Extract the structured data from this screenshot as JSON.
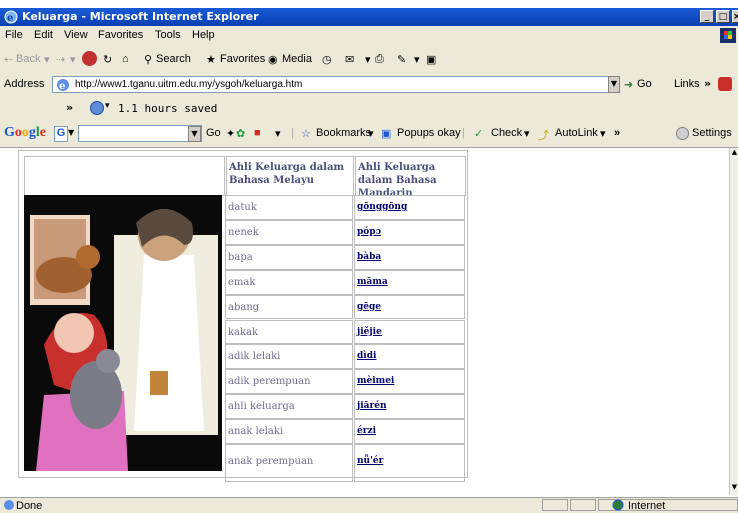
{
  "window": {
    "title": "Keluarga - Microsoft Internet Explorer",
    "buttons": [
      "_",
      "×"
    ]
  },
  "menu": {
    "items": [
      "File",
      "Edit",
      "View",
      "Favorites",
      "Tools",
      "Help"
    ]
  },
  "toolbar": {
    "back": "Back",
    "search": "Search",
    "favorites": "Favorites",
    "media": "Media"
  },
  "address": {
    "label": "Address",
    "url": "http://www1.tganu.uitm.edu.my/ysgoh/keluarga.htm",
    "go": "Go",
    "links": "Links"
  },
  "saved": {
    "chevron": "»",
    "text": "1.1 hours saved"
  },
  "google_bar": {
    "logo": "Google",
    "g_button": "G",
    "go": "Go",
    "bookmarks": "Bookmarks",
    "popups": "Popups okay",
    "check": "Check",
    "autolink": "AutoLink",
    "more": "»",
    "settings": "Settings"
  },
  "table": {
    "header_malay": "Ahli Keluarga dalam Bahasa Melayu",
    "header_mandarin": "Ahli Keluarga dalam Bahasa Mandarin",
    "rows": [
      {
        "malay": "datuk",
        "mandarin": "gōnggōng"
      },
      {
        "malay": "nenek",
        "mandarin": "pópɔ"
      },
      {
        "malay": "bapa",
        "mandarin": "bàba"
      },
      {
        "malay": "emak",
        "mandarin": "māma"
      },
      {
        "malay": "abang",
        "mandarin": "gēge"
      },
      {
        "malay": "kakak",
        "mandarin": "jiějie"
      },
      {
        "malay": "adik lelaki",
        "mandarin": "dìdi"
      },
      {
        "malay": "adik perempuan",
        "mandarin": "mèimei"
      },
      {
        "malay": "ahli keluarga",
        "mandarin": "jiārén"
      },
      {
        "malay": "anak lelaki",
        "mandarin": "érzi"
      },
      {
        "malay": "anak perempuan",
        "mandarin": "nǚ'ér"
      }
    ]
  },
  "status": {
    "left": "Done",
    "zone": "Internet"
  },
  "colors": {
    "title_bar": "#0a3fb2",
    "chrome": "#ece9d8",
    "link": "#00006e",
    "header_text": "#4a4f7a",
    "cell_text": "#6e6e8e"
  }
}
